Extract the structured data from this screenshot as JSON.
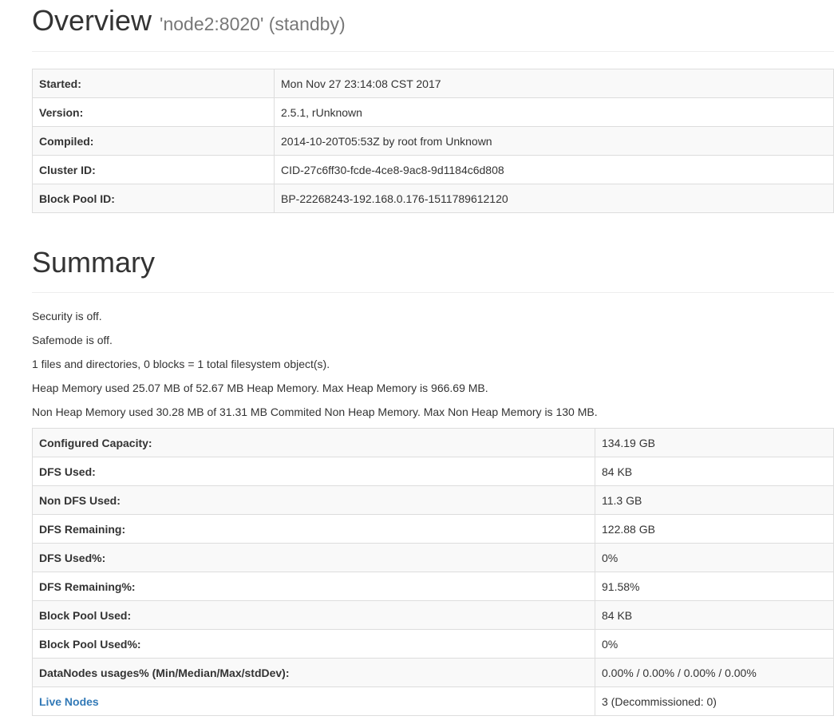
{
  "overview": {
    "title": "Overview",
    "subtitle": "'node2:8020' (standby)",
    "rows": [
      {
        "label": "Started:",
        "value": "Mon Nov 27 23:14:08 CST 2017"
      },
      {
        "label": "Version:",
        "value": "2.5.1, rUnknown"
      },
      {
        "label": "Compiled:",
        "value": "2014-10-20T05:53Z by root from Unknown"
      },
      {
        "label": "Cluster ID:",
        "value": "CID-27c6ff30-fcde-4ce8-9ac8-9d1184c6d808"
      },
      {
        "label": "Block Pool ID:",
        "value": "BP-22268243-192.168.0.176-1511789612120"
      }
    ]
  },
  "summary": {
    "title": "Summary",
    "lines": [
      "Security is off.",
      "Safemode is off.",
      "1 files and directories, 0 blocks = 1 total filesystem object(s).",
      "Heap Memory used 25.07 MB of 52.67 MB Heap Memory. Max Heap Memory is 966.69 MB.",
      "Non Heap Memory used 30.28 MB of 31.31 MB Commited Non Heap Memory. Max Non Heap Memory is 130 MB."
    ],
    "rows": [
      {
        "label": "Configured Capacity:",
        "value": "134.19 GB"
      },
      {
        "label": "DFS Used:",
        "value": "84 KB"
      },
      {
        "label": "Non DFS Used:",
        "value": "11.3 GB"
      },
      {
        "label": "DFS Remaining:",
        "value": "122.88 GB"
      },
      {
        "label": "DFS Used%:",
        "value": "0%"
      },
      {
        "label": "DFS Remaining%:",
        "value": "91.58%"
      },
      {
        "label": "Block Pool Used:",
        "value": "84 KB"
      },
      {
        "label": "Block Pool Used%:",
        "value": "0%"
      },
      {
        "label": "DataNodes usages% (Min/Median/Max/stdDev):",
        "value": "0.00% / 0.00% / 0.00% / 0.00%"
      },
      {
        "label": "Live Nodes",
        "value": "3 (Decommissioned: 0)"
      }
    ]
  }
}
